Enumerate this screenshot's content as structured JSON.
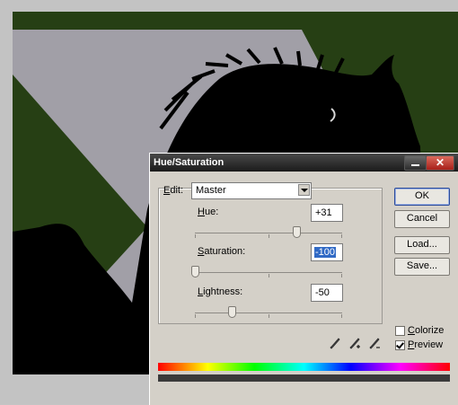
{
  "dialog": {
    "title": "Hue/Saturation",
    "close_glyph": "✕",
    "edit": {
      "label_first": "E",
      "label_rest": "dit:",
      "value": "Master"
    },
    "hue": {
      "label_first": "H",
      "label_rest": "ue:",
      "value": "+31",
      "fraction": 0.69
    },
    "saturation": {
      "label_first": "S",
      "label_rest": "aturation:",
      "value": "-100",
      "fraction": 0.0
    },
    "lightness": {
      "label_first": "L",
      "label_rest": "ightness:",
      "value": "-50",
      "fraction": 0.25
    },
    "buttons": {
      "ok": "OK",
      "cancel": "Cancel",
      "load": "Load...",
      "save": "Save..."
    },
    "colorize": {
      "label_first": "C",
      "label_rest": "olorize",
      "checked": false
    },
    "preview": {
      "label_first": "P",
      "label_rest": "review",
      "checked": true
    }
  },
  "colors": {
    "background_green": "#263f14",
    "canvas_gray": "#c3c3c3",
    "dialog_face": "#d4d0c8"
  },
  "icons": [
    "eyedropper-icon",
    "eyedropper-plus-icon",
    "eyedropper-minus-icon",
    "close-icon",
    "minimize-icon",
    "chevron-down-icon"
  ]
}
